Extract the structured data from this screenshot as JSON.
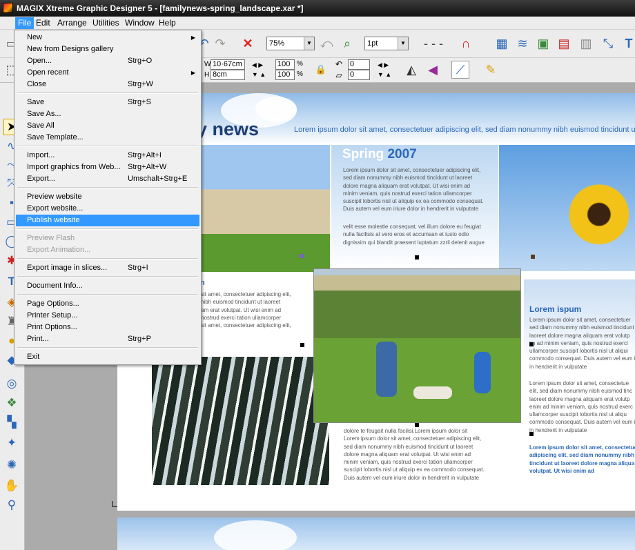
{
  "window": {
    "title": "MAGIX Xtreme Graphic Designer 5 - [familynews-spring_landscape.xar *]"
  },
  "menubar": [
    "File",
    "Edit",
    "Arrange",
    "Utilities",
    "Window",
    "Help"
  ],
  "toolbar": {
    "zoom_value": "75%",
    "line_width_value": "1pt"
  },
  "infobar": {
    "width_value": "10·67cm",
    "height_value": "8cm",
    "scale_x": "100",
    "scale_y": "100",
    "rot_value": "0",
    "skew_value": "0"
  },
  "file_menu": {
    "items": [
      {
        "label": "New",
        "shortcut": "",
        "submenu": true
      },
      {
        "label": "New from Designs gallery",
        "shortcut": ""
      },
      {
        "label": "Open...",
        "shortcut": "Strg+O"
      },
      {
        "label": "Open recent",
        "shortcut": "",
        "submenu": true
      },
      {
        "label": "Close",
        "shortcut": "Strg+W"
      },
      {
        "label": "Save",
        "shortcut": "Strg+S"
      },
      {
        "label": "Save As...",
        "shortcut": ""
      },
      {
        "label": "Save All",
        "shortcut": ""
      },
      {
        "label": "Save Template...",
        "shortcut": ""
      },
      {
        "label": "Import...",
        "shortcut": "Strg+Alt+I"
      },
      {
        "label": "Import graphics from Web...",
        "shortcut": "Strg+Alt+W"
      },
      {
        "label": "Export...",
        "shortcut": "Umschalt+Strg+E"
      },
      {
        "label": "Preview website",
        "shortcut": ""
      },
      {
        "label": "Export website...",
        "shortcut": ""
      },
      {
        "label": "Publish website",
        "shortcut": "",
        "highlighted": true
      },
      {
        "label": "Preview Flash",
        "shortcut": "",
        "disabled": true
      },
      {
        "label": "Export Animation...",
        "shortcut": "",
        "disabled": true
      },
      {
        "label": "Export image in slices...",
        "shortcut": "Strg+I"
      },
      {
        "label": "Document Info...",
        "shortcut": ""
      },
      {
        "label": "Page Options...",
        "shortcut": ""
      },
      {
        "label": "Printer Setup...",
        "shortcut": ""
      },
      {
        "label": "Print Options...",
        "shortcut": ""
      },
      {
        "label": "Print...",
        "shortcut": "Strg+P"
      },
      {
        "label": "Exit",
        "shortcut": ""
      }
    ]
  },
  "document": {
    "title": "ily news",
    "tagline": "Lorem ipsum dolor sit amet, consectetuer adipiscing elit, sed diam nonummy nibh euismod tincidunt ut laoreet d",
    "spring_title_a": "Spring",
    "spring_title_b": "2007",
    "spring_text_1": "Lorem ipsum dolor sit amet, consectetuer adipiscing elit,\nsed diam nonummy nibh euismod tincidunt ut laoreet\ndolore magna aliquam erat volutpat. Ut wisi enim ad\nminim veniam, quis nostrud exerci tation ullamcorper\nsuscipit lobortis nisl ut aliquip ex ea commodo consequat.\nDuis autem vel eum iriure dolor in hendrerit in vulputate",
    "spring_text_2": "velit esse molestie consequat, vel illum dolore eu feugiat\nnulla facilisis at vero eros et accumsan et iusto odio\ndignissim qui blandit praesent luptatum zzril delenit augue",
    "left_heading": "n",
    "left_text": "sit amet, consectetuer adipiscing elit,\nnibh euismod tincidunt ut laoreet\nam erat volutpat. Ut wisi enim ad\nnostrud exerci tation ullamcorper\nsit amet, consectetuer adipiscing elit,",
    "center_text": "dolore te feugait nulla facilisi.Lorem ipsum dolor sit\nLorem ipsum dolor sit amet, consectetuer adipiscing elit,\nsed diam nonummy nibh euismod tincidunt ut laoreet\ndolore magna aliquam erat volutpat. Ut wisi enim ad\nminim veniam, quis nostrud exerci tation ullamcorper\nsuscipit lobortis nisl ut aliquip ex ea commodo consequat.\nDuis autem vel eum iriure dolor in hendrerit in vulputate",
    "right_heading": "Lorem ispum",
    "right_text_1": "Lorem ipsum dolor sit amet, consectetuer\nsed diam nonummy nibh euismod tincidunt\nlaoreet dolore magna aliquam erat volutp\nim ad minim veniam, quis nostrud exerci\nullamcorper suscipit lobortis nisl ut aliqui\ncommodo consequat. Duis autem vel eum in\nin hendrerit in vulputate",
    "right_text_2": "Lorem ipsum dolor sit amet, consectetue\nelit, sed diam nonummy nibh euismod tinc\nlaoreet dolore magna aliquam erat volutp\nenim ad minim veniam, quis nostrud exerc\nullamcorper suscipit lobortis nisl ut aliqu\ncommodo consequat. Duis autem vel eum i\nin hendrerit in vulputate",
    "right_bold": "Lorem ipsum dolor sit amet, consectetuer\nadipiscing elit, sed diam nonummy nibh\ntincidunt ut laoreet dolore magna aliqua\nvolutpat. Ut wisi enim ad"
  },
  "colors": {
    "highlight": "#3399ff",
    "title_blue": "#1f3e73",
    "accent_blue": "#2a67b8"
  }
}
